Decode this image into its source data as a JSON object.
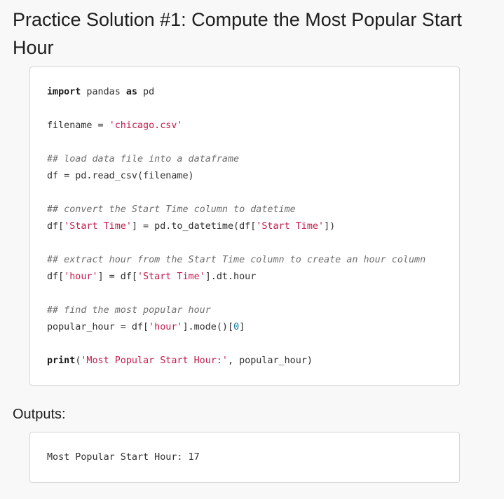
{
  "page": {
    "title": "Practice Solution #1: Compute the Most Popular Start Hour",
    "outputs_label": "Outputs:"
  },
  "code": {
    "lines": [
      [
        {
          "t": "import",
          "c": "kw"
        },
        {
          "t": " pandas "
        },
        {
          "t": "as",
          "c": "kw"
        },
        {
          "t": " pd"
        }
      ],
      [],
      [
        {
          "t": "filename = "
        },
        {
          "t": "'chicago.csv'",
          "c": "str"
        }
      ],
      [],
      [
        {
          "t": "## load data file into a dataframe",
          "c": "com"
        }
      ],
      [
        {
          "t": "df = pd.read_csv(filename)"
        }
      ],
      [],
      [
        {
          "t": "## convert the Start Time column to datetime",
          "c": "com"
        }
      ],
      [
        {
          "t": "df["
        },
        {
          "t": "'Start Time'",
          "c": "str"
        },
        {
          "t": "] = pd.to_datetime(df["
        },
        {
          "t": "'Start Time'",
          "c": "str"
        },
        {
          "t": "])"
        }
      ],
      [],
      [
        {
          "t": "## extract hour from the Start Time column to create an hour column",
          "c": "com"
        }
      ],
      [
        {
          "t": "df["
        },
        {
          "t": "'hour'",
          "c": "str"
        },
        {
          "t": "] = df["
        },
        {
          "t": "'Start Time'",
          "c": "str"
        },
        {
          "t": "].dt.hour"
        }
      ],
      [],
      [
        {
          "t": "## find the most popular hour",
          "c": "com"
        }
      ],
      [
        {
          "t": "popular_hour = df["
        },
        {
          "t": "'hour'",
          "c": "str"
        },
        {
          "t": "].mode()["
        },
        {
          "t": "0",
          "c": "num"
        },
        {
          "t": "]"
        }
      ],
      [],
      [
        {
          "t": "print",
          "c": "kw"
        },
        {
          "t": "("
        },
        {
          "t": "'Most Popular Start Hour:'",
          "c": "str"
        },
        {
          "t": ", popular_hour)"
        }
      ]
    ]
  },
  "output": {
    "text": "Most Popular Start Hour: 17"
  }
}
